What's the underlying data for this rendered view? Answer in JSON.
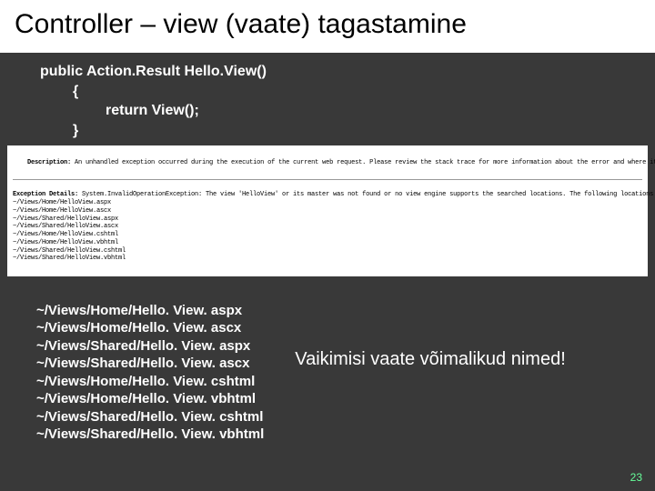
{
  "title": "Controller – view (vaate) tagastamine",
  "code": {
    "line1": "public Action.Result Hello.View()",
    "line2a": "{",
    "line3": "return View();",
    "line2b": "}"
  },
  "error": {
    "desc_label": "Description:",
    "desc_text": " An unhandled exception occurred during the execution of the current web request. Please review the stack trace for more information about the error and where it originated in the code.",
    "detail_label": "Exception Details:",
    "detail_text": " System.InvalidOperationException: The view 'HelloView' or its master was not found or no view engine supports the searched locations. The following locations were searched:",
    "searched": [
      "~/Views/Home/HelloView.aspx",
      "~/Views/Home/HelloView.ascx",
      "~/Views/Shared/HelloView.aspx",
      "~/Views/Shared/HelloView.ascx",
      "~/Views/Home/HelloView.cshtml",
      "~/Views/Home/HelloView.vbhtml",
      "~/Views/Shared/HelloView.cshtml",
      "~/Views/Shared/HelloView.vbhtml"
    ]
  },
  "paths": [
    "~/Views/Home/Hello. View. aspx",
    "~/Views/Home/Hello. View. ascx",
    "~/Views/Shared/Hello. View. aspx",
    "~/Views/Shared/Hello. View. ascx",
    "~/Views/Home/Hello. View. cshtml",
    "~/Views/Home/Hello. View. vbhtml",
    "~/Views/Shared/Hello. View. cshtml",
    "~/Views/Shared/Hello. View. vbhtml"
  ],
  "caption": "Vaikimisi vaate võimalikud nimed!",
  "page": "23"
}
